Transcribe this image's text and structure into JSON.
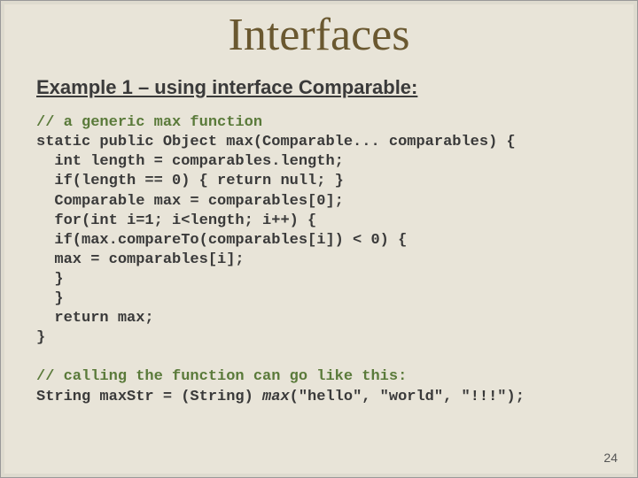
{
  "title": "Interfaces",
  "subtitle": "Example 1 – using interface Comparable:",
  "code": {
    "c1": "// a generic max function",
    "l2": "static public Object max(Comparable... comparables) {",
    "l3": "  int length = comparables.length;",
    "l4": "  if(length == 0) { return null; }",
    "l5": "  Comparable max = comparables[0];",
    "l6": "  for(int i=1; i<length; i++) {",
    "l7": "  if(max.compareTo(comparables[i]) < 0) {",
    "l8": "  max = comparables[i];",
    "l9": "  }",
    "l10": "  }",
    "l11": "  return max;",
    "l12": "}",
    "blank": "",
    "c13": "// calling the function can go like this:",
    "l14a": "String maxStr = (String) ",
    "l14b": "max",
    "l14c": "(\"hello\", \"world\", \"!!!\");"
  },
  "page_number": "24"
}
